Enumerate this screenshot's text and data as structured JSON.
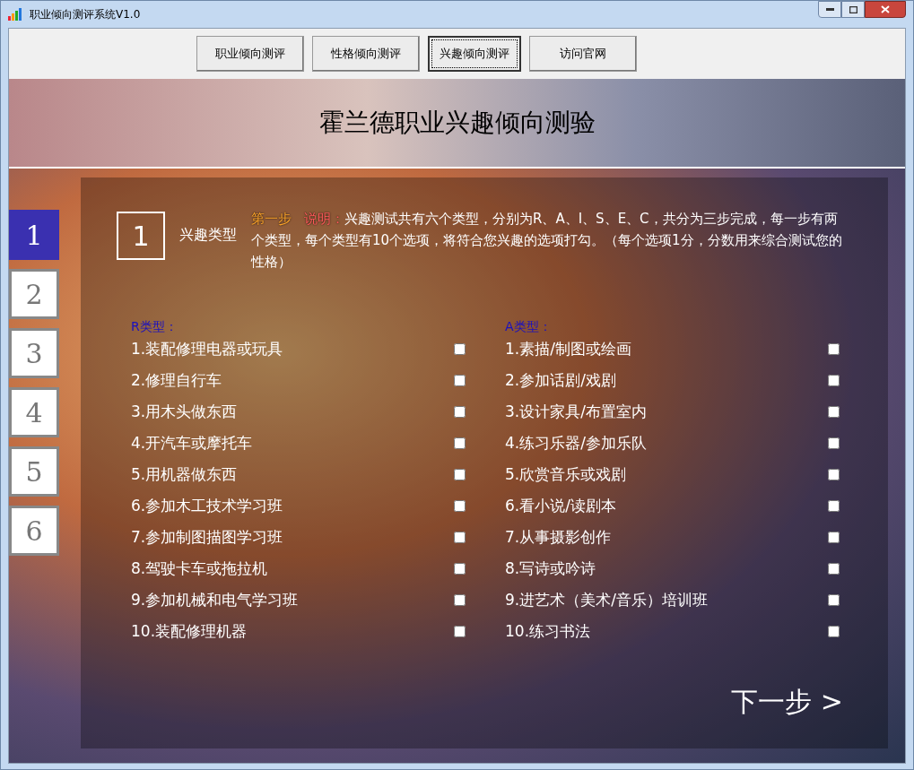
{
  "window": {
    "title": "职业倾向测评系统V1.0"
  },
  "toolbar": [
    {
      "label": "职业倾向测评",
      "selected": false
    },
    {
      "label": "性格倾向测评",
      "selected": false
    },
    {
      "label": "兴趣倾向测评",
      "selected": true
    },
    {
      "label": "访问官网",
      "selected": false
    }
  ],
  "header": {
    "title": "霍兰德职业兴趣倾向测验"
  },
  "steps": [
    {
      "label": "1",
      "selected": true
    },
    {
      "label": "2",
      "selected": false
    },
    {
      "label": "3",
      "selected": false
    },
    {
      "label": "4",
      "selected": false
    },
    {
      "label": "5",
      "selected": false
    },
    {
      "label": "6",
      "selected": false
    }
  ],
  "intro": {
    "number": "1",
    "heading": "兴趣类型",
    "step_label": "第一步",
    "note_label": "说明：",
    "text": "兴趣测试共有六个类型，分别为R、A、I、S、E、C，共分为三步完成，每一步有两个类型，每个类型有10个选项，将符合您兴趣的选项打勾。（每个选项1分，分数用来综合测试您的性格）"
  },
  "groups": [
    {
      "title": "R类型：",
      "items": [
        {
          "label": "1.装配修理电器或玩具",
          "checked": false
        },
        {
          "label": "2.修理自行车",
          "checked": false
        },
        {
          "label": "3.用木头做东西",
          "checked": false
        },
        {
          "label": "4.开汽车或摩托车",
          "checked": false
        },
        {
          "label": "5.用机器做东西",
          "checked": false
        },
        {
          "label": "6.参加木工技术学习班",
          "checked": false
        },
        {
          "label": "7.参加制图描图学习班",
          "checked": false
        },
        {
          "label": "8.驾驶卡车或拖拉机",
          "checked": false
        },
        {
          "label": "9.参加机械和电气学习班",
          "checked": false
        },
        {
          "label": "10.装配修理机器",
          "checked": false
        }
      ]
    },
    {
      "title": "A类型：",
      "items": [
        {
          "label": "1.素描/制图或绘画",
          "checked": false
        },
        {
          "label": "2.参加话剧/戏剧",
          "checked": false
        },
        {
          "label": "3.设计家具/布置室内",
          "checked": false
        },
        {
          "label": "4.练习乐器/参加乐队",
          "checked": false
        },
        {
          "label": "5.欣赏音乐或戏剧",
          "checked": false
        },
        {
          "label": "6.看小说/读剧本",
          "checked": false
        },
        {
          "label": "7.从事摄影创作",
          "checked": false
        },
        {
          "label": "8.写诗或吟诗",
          "checked": false
        },
        {
          "label": "9.进艺术（美术/音乐）培训班",
          "checked": false
        },
        {
          "label": "10.练习书法",
          "checked": false
        }
      ]
    }
  ],
  "next_button": {
    "label": "下一步 >"
  }
}
